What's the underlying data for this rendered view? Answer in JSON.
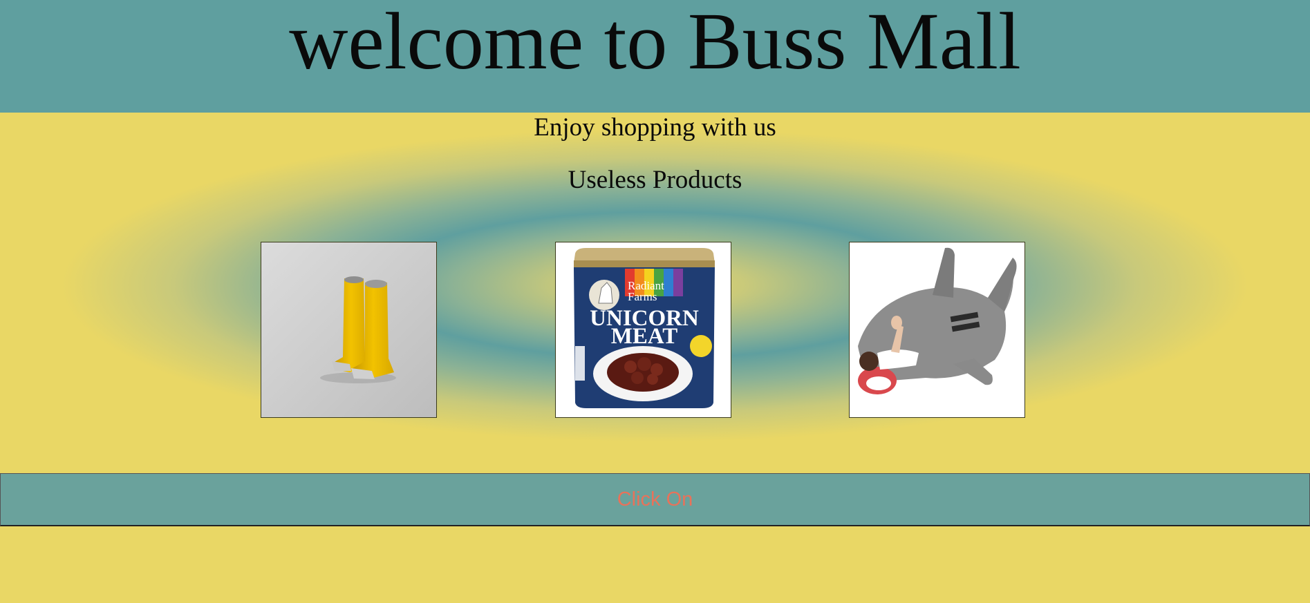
{
  "header": {
    "title": "welcome to Buss Mall"
  },
  "main": {
    "subtitle": "Enjoy shopping with us",
    "section_heading": "Useless Products",
    "products": [
      {
        "name": "boots-image"
      },
      {
        "name": "unicorn-meat-image",
        "label_brand": "Radiant Farms",
        "label_line1": "UNICORN",
        "label_line2": "MEAT"
      },
      {
        "name": "shark-sleeping-bag-image"
      }
    ]
  },
  "button": {
    "label": "Click On"
  },
  "colors": {
    "header_bg": "#5f9f9f",
    "page_bg": "#e9d765",
    "button_bg": "#6aa29c",
    "button_text": "#e8725a"
  }
}
